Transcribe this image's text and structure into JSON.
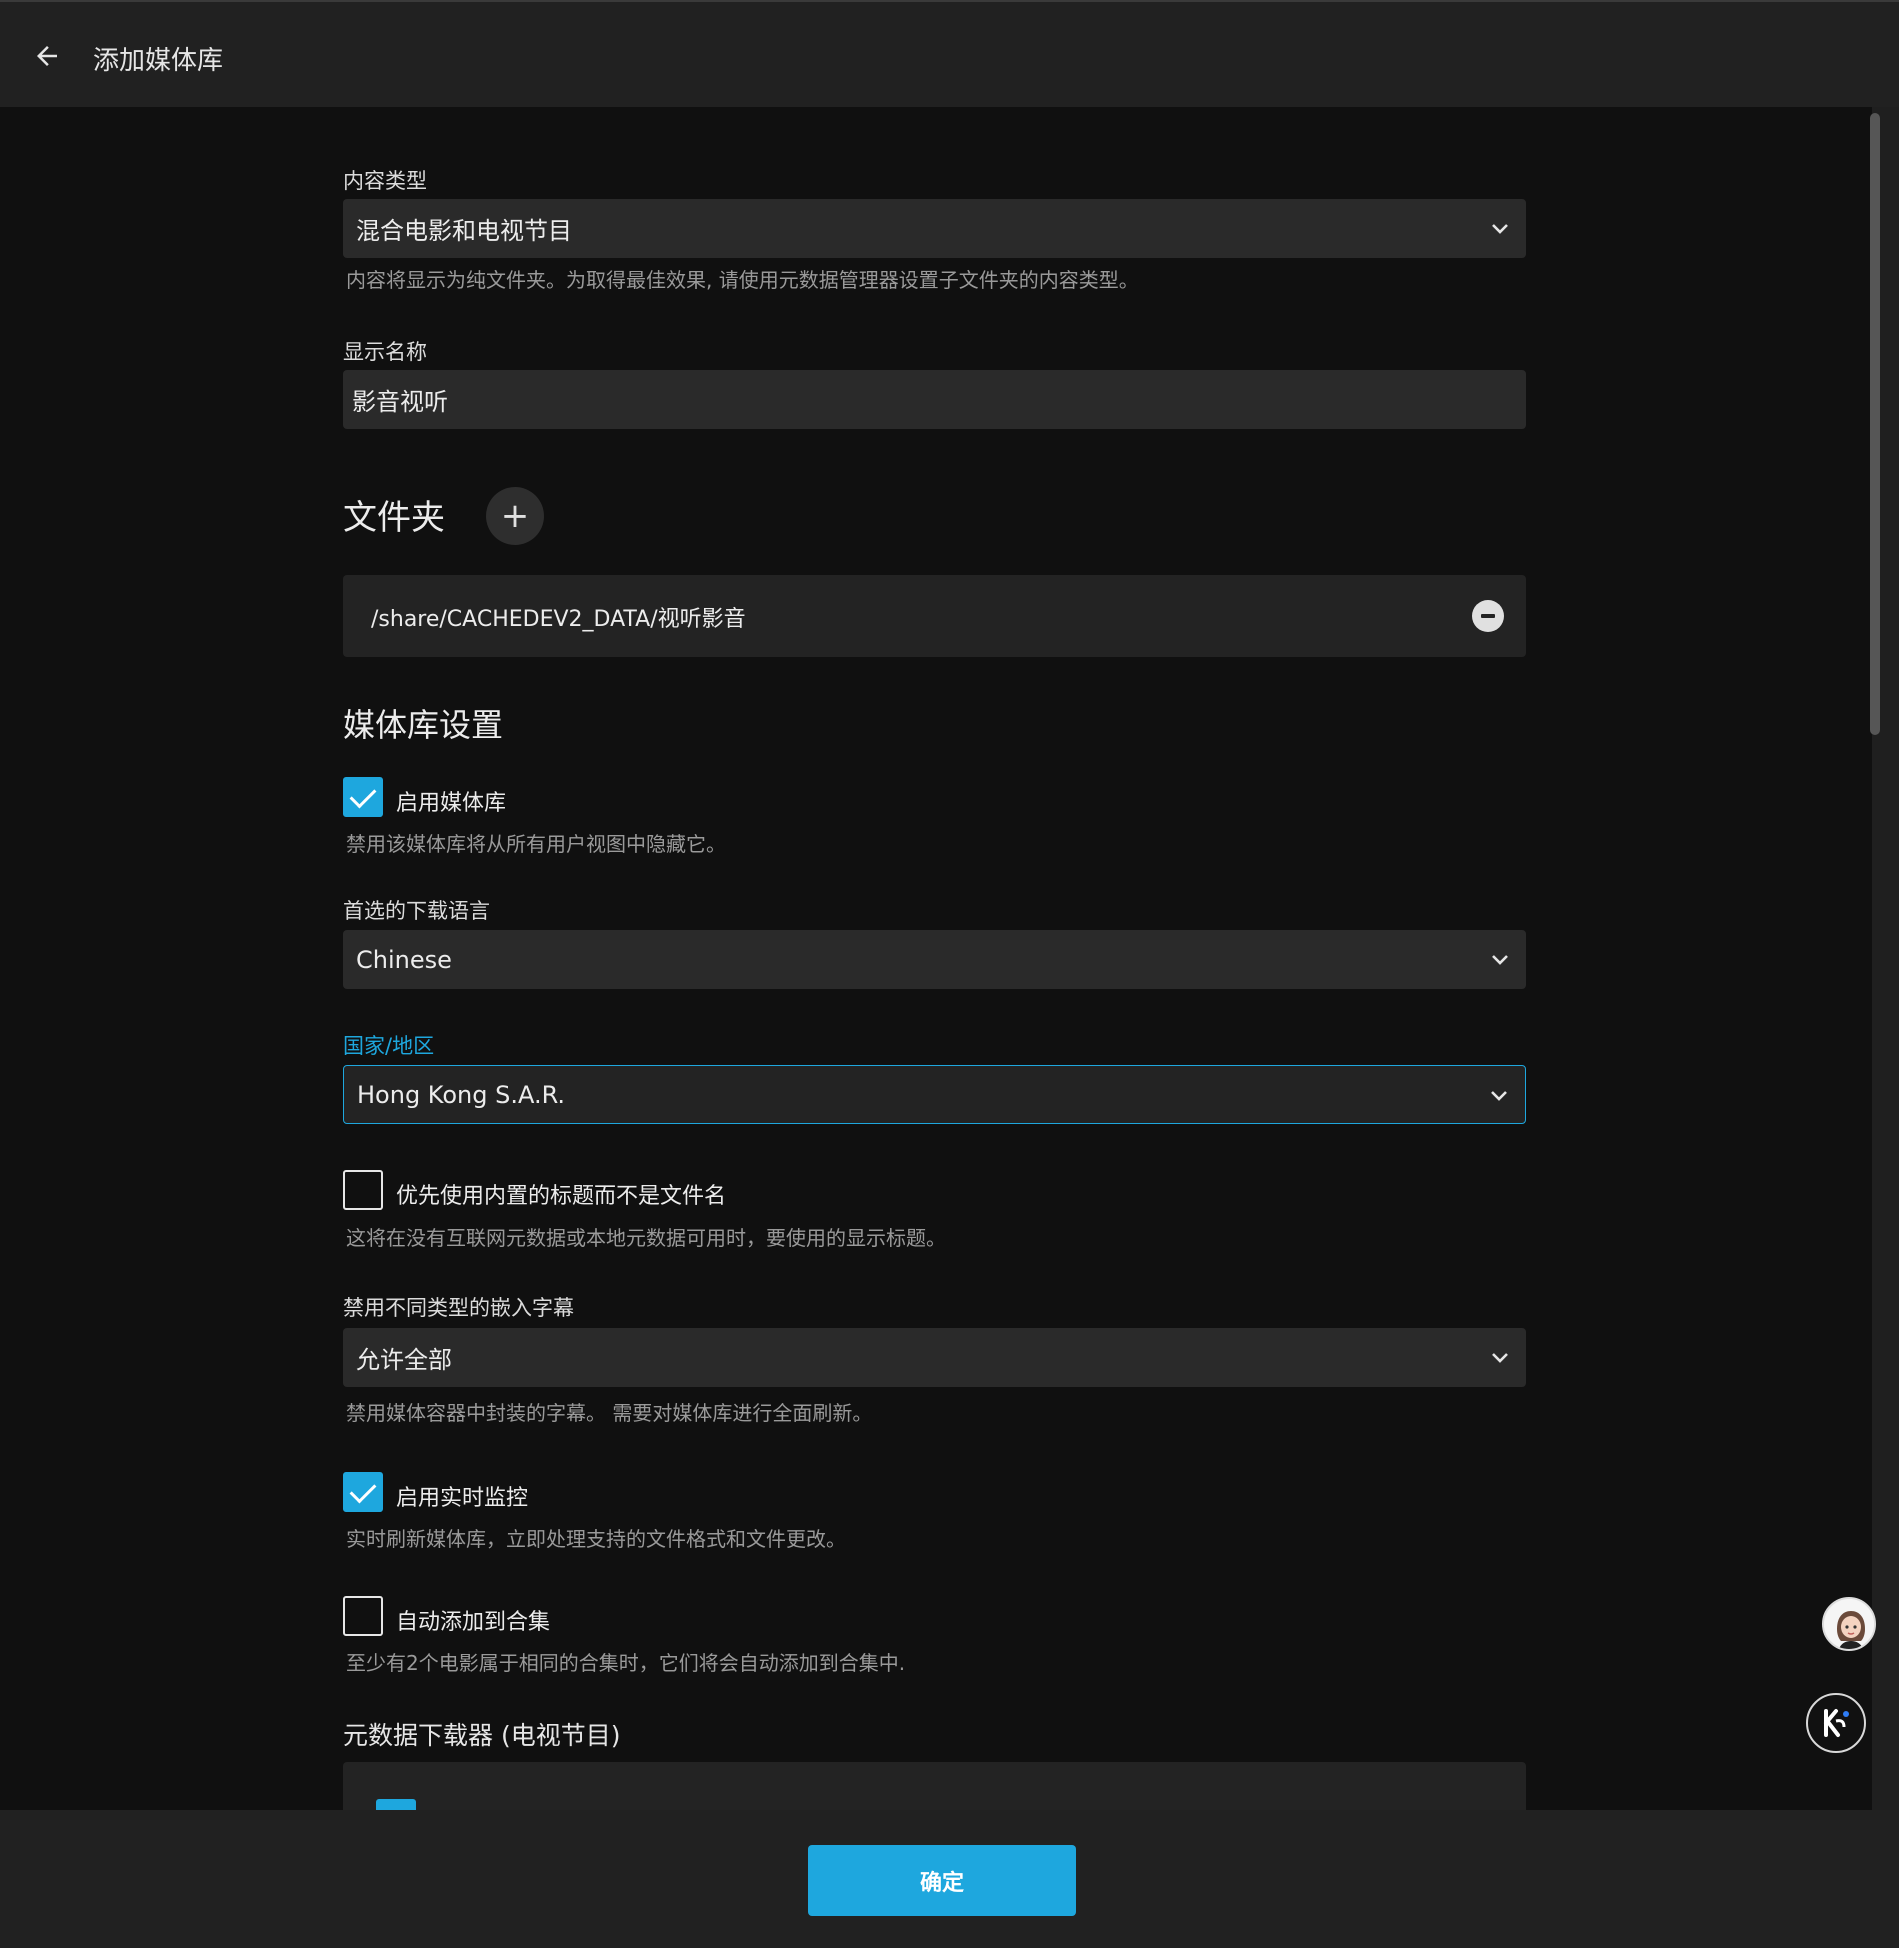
{
  "header": {
    "title": "添加媒体库"
  },
  "form": {
    "content_type": {
      "label": "内容类型",
      "value": "混合电影和电视节目",
      "help": "内容将显示为纯文件夹。为取得最佳效果, 请使用元数据管理器设置子文件夹的内容类型。"
    },
    "display_name": {
      "label": "显示名称",
      "value": "影音视听"
    },
    "folders": {
      "heading": "文件夹",
      "add_symbol": "+",
      "items": [
        "/share/CACHEDEV2_DATA/视听影音"
      ]
    },
    "library_settings": {
      "heading": "媒体库设置",
      "enable_library": {
        "label": "启用媒体库",
        "checked": true,
        "help": "禁用该媒体库将从所有用户视图中隐藏它。"
      },
      "download_language": {
        "label": "首选的下载语言",
        "value": "Chinese"
      },
      "country": {
        "label": "国家/地区",
        "value": "Hong Kong S.A.R."
      },
      "prefer_embedded_titles": {
        "label": "优先使用内置的标题而不是文件名",
        "checked": false,
        "help": "这将在没有互联网元数据或本地元数据可用时，要使用的显示标题。"
      },
      "disable_subtitles": {
        "label": "禁用不同类型的嵌入字幕",
        "value": "允许全部",
        "help": "禁用媒体容器中封装的字幕。 需要对媒体库进行全面刷新。"
      },
      "realtime_monitor": {
        "label": "启用实时监控",
        "checked": true,
        "help": "实时刷新媒体库，立即处理支持的文件格式和文件更改。"
      },
      "auto_collections": {
        "label": "自动添加到合集",
        "checked": false,
        "help": "至少有2个电影属于相同的合集时，它们将会自动添加到合集中."
      },
      "metadata_downloaders_tv": {
        "heading": "元数据下载器 (电视节目)"
      }
    }
  },
  "footer": {
    "ok_label": "确定"
  },
  "colors": {
    "accent": "#1ea7de",
    "background": "#101010",
    "header": "#212121",
    "field": "#2a2a2a"
  },
  "icons": {
    "back": "arrow-left-icon",
    "chevron": "chevron-down-icon",
    "remove": "minus-circle-icon",
    "check": "checkmark-icon"
  }
}
